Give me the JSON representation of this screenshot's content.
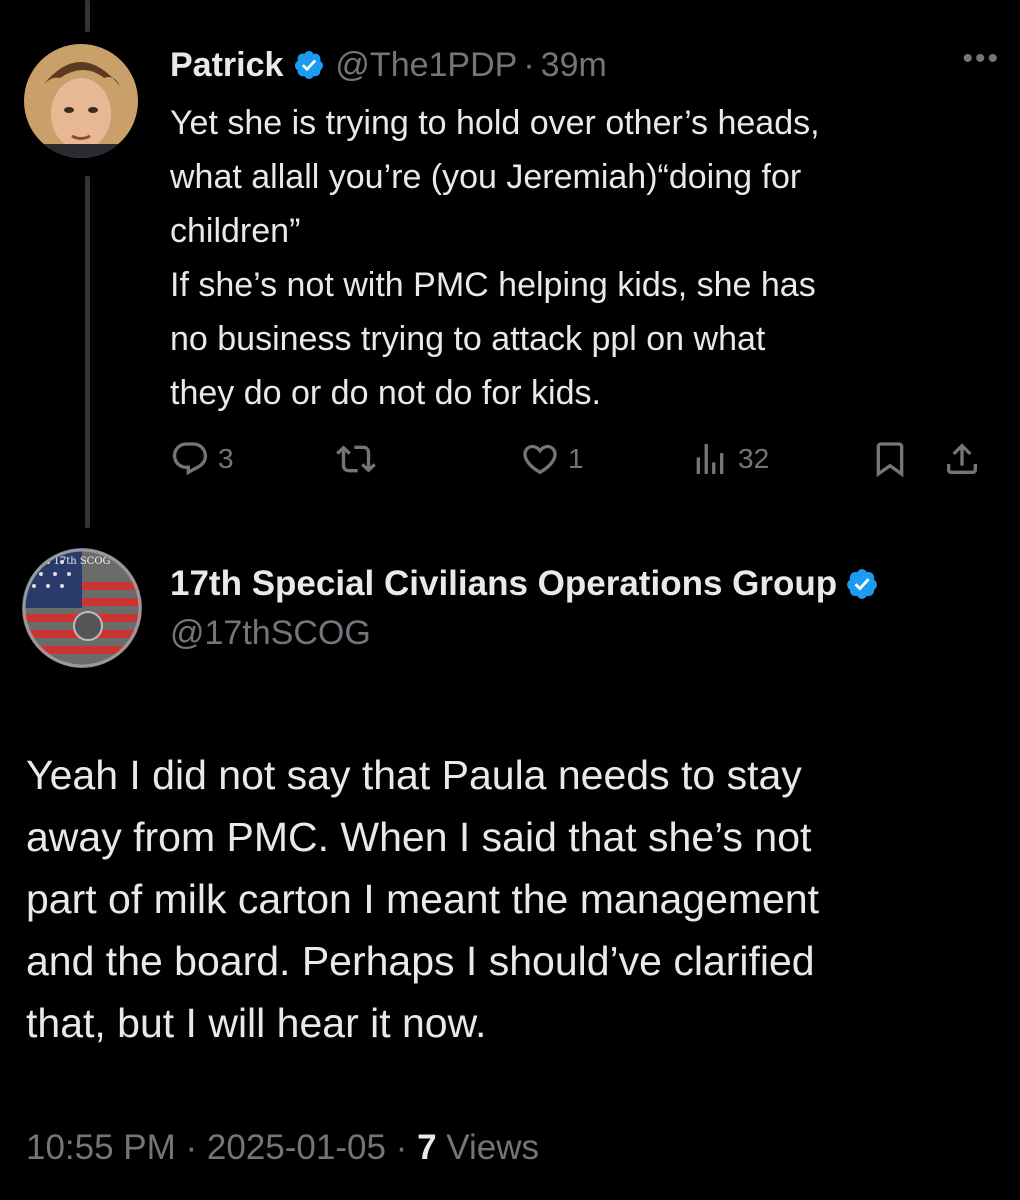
{
  "parent_tweet": {
    "author_name": "Patrick",
    "handle": "@The1PDP",
    "separator": "·",
    "time": "39m",
    "more_label": "•••",
    "text": "Yet she is trying to hold over other’s heads,\nwhat allall you’re (you Jeremiah)“doing for\nchildren”\nIf she’s not with PMC helping kids, she has\nno business trying to attack ppl on what\nthey do or do not do for kids.",
    "actions": {
      "reply_icon": "reply-icon",
      "reply_count": "3",
      "retweet_icon": "retweet-icon",
      "like_icon": "heart-icon",
      "like_count": "1",
      "views_icon": "views-icon",
      "views_count": "32",
      "bookmark_icon": "bookmark-icon",
      "share_icon": "share-icon"
    }
  },
  "reply_tweet": {
    "author_name": "17th Special Civilians Operations Group",
    "handle": "@17thSCOG",
    "avatar_text": "17th SCOG",
    "text": "Yeah I did not say that Paula needs to stay\naway from PMC. When I said that she’s not\npart of milk carton I meant the management\nand the board. Perhaps I should’ve clarified\nthat, but I will hear it now.",
    "timestamp": "10:55 PM · 2025-01-05 · ",
    "views_count": "7",
    "views_label": " Views"
  },
  "colors": {
    "background": "#000000",
    "text": "#e7e9ea",
    "secondary": "#71767b",
    "verified": "#1d9bf0",
    "thread_line": "#333639"
  }
}
